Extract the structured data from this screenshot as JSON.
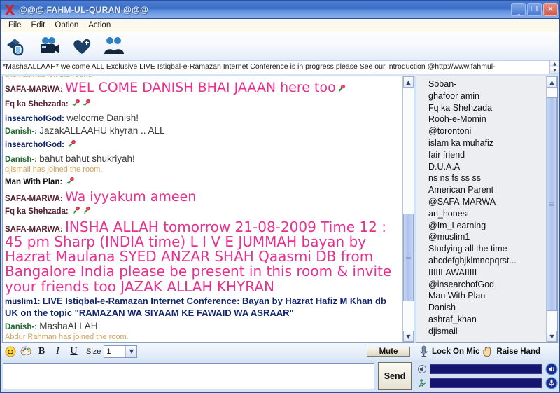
{
  "window": {
    "title": "@@@ FAHM-UL-QURAN @@@",
    "logo_icon": "red-x-logo",
    "minimize_label": "_",
    "restore_label": "❐",
    "close_label": "✕"
  },
  "menubar": {
    "items": [
      {
        "label": "File"
      },
      {
        "label": "Edit"
      },
      {
        "label": "Option"
      },
      {
        "label": "Action"
      }
    ]
  },
  "toolbar": {
    "buttons": [
      {
        "icon": "megaphone-broadcast-icon",
        "label": "Broadcast"
      },
      {
        "icon": "video-camera-icon",
        "label": "Webcam"
      },
      {
        "icon": "heart-plus-add-friend-icon",
        "label": "Add Friend"
      },
      {
        "icon": "people-users-icon",
        "label": "Users"
      }
    ]
  },
  "banner": {
    "text": "*MashaALLAAH* welcome ALL Exclusive LIVE Istiqbal-e-Ramazan Internet Conference is in progress please See our introduction @http://www.fahmul-",
    "scroll_up_icon": "caret-up-icon",
    "scroll_down_icon": "caret-down-icon"
  },
  "chat": {
    "messages": [
      {
        "type": "system",
        "text": "djismail has left the room."
      },
      {
        "type": "msg",
        "nick": "SAFA-MARWA:",
        "nick_color": "maroon",
        "text": "WEL COME DANISH BHAI JAAAN here too",
        "style": "pink",
        "roses": 1
      },
      {
        "type": "msg",
        "nick": "Fq ka Shehzada:",
        "nick_color": "maroon",
        "text": "",
        "style": "pink",
        "roses": 2
      },
      {
        "type": "msg",
        "nick": "insearchofGod:",
        "nick_color": "navy",
        "text": "welcome Danish!",
        "style": "plain",
        "roses": 0
      },
      {
        "type": "msg",
        "nick": "Danish-:",
        "nick_color": "green",
        "text": "JazakALLAAHU khyran .. ALL",
        "style": "plain",
        "roses": 0
      },
      {
        "type": "msg",
        "nick": "insearchofGod:",
        "nick_color": "navy",
        "text": "",
        "style": "plain",
        "roses": 1
      },
      {
        "type": "msg",
        "nick": "Danish-:",
        "nick_color": "green",
        "text": "bahut bahut shukriyah!",
        "style": "plain",
        "roses": 0
      },
      {
        "type": "system",
        "text": "djismail has joined the room."
      },
      {
        "type": "msg",
        "nick": "Man With Plan:",
        "nick_color": "black",
        "text": "",
        "style": "plain",
        "roses": 1
      },
      {
        "type": "msg",
        "nick": "SAFA-MARWA:",
        "nick_color": "maroon",
        "text": "Wa iyyakum ameen",
        "style": "pink",
        "roses": 0
      },
      {
        "type": "msg",
        "nick": "Fq ka Shehzada:",
        "nick_color": "maroon",
        "text": "",
        "style": "pink",
        "roses": 2
      },
      {
        "type": "msg",
        "nick": "SAFA-MARWA:",
        "nick_color": "maroon",
        "text": "INSHA ALLAH tomorrow 21-08-2009 Time 12 : 45 pm Sharp (INDIA time)  L I V E  JUMMAH bayan by Hazrat Maulana SYED ANZAR SHAH Qaasmi DB from Bangalore India please be present in this room & invite your friends too JAZAK ALLAH KHYRAN",
        "style": "pink-big",
        "roses": 0
      },
      {
        "type": "msg",
        "nick": "muslim1:",
        "nick_color": "navy",
        "text": "LIVE Istiqbal-e-Ramazan Internet Conference: Bayan by Hazrat Hafiz M Khan db UK on the topic \"RAMAZAN WA SIYAAM KE FAWAID WA ASRAAR\"",
        "style": "navybold",
        "roses": 0
      },
      {
        "type": "msg",
        "nick": "Danish-:",
        "nick_color": "green",
        "text": "MashaALLAH",
        "style": "plain",
        "roses": 0
      },
      {
        "type": "system",
        "text": "Abdur Rahman has joined the room."
      }
    ],
    "scroll_up_icon": "caret-up-icon",
    "scroll_down_icon": "caret-down-icon"
  },
  "users": {
    "items": [
      {
        "name": "Soban-"
      },
      {
        "name": "ghafoor amin"
      },
      {
        "name": "Fq ka Shehzada"
      },
      {
        "name": "Rooh-e-Momin"
      },
      {
        "name": "@torontoni"
      },
      {
        "name": "islam ka muhafiz"
      },
      {
        "name": "fair friend"
      },
      {
        "name": "D.U.A.A"
      },
      {
        "name": "ns ns fs ss ss"
      },
      {
        "name": "American Parent"
      },
      {
        "name": "@SAFA-MARWA"
      },
      {
        "name": "an_honest"
      },
      {
        "name": "@Im_Learning"
      },
      {
        "name": "@muslim1"
      },
      {
        "name": "Studying all the time"
      },
      {
        "name": "abcdefghjklmnopqrst..."
      },
      {
        "name": "IIIIILAWAIIIII"
      },
      {
        "name": "@insearchofGod"
      },
      {
        "name": "Man With Plan"
      },
      {
        "name": "Danish-"
      },
      {
        "name": "ashraf_khan"
      },
      {
        "name": "djismail"
      }
    ],
    "scroll_up_icon": "caret-up-icon",
    "scroll_down_icon": "caret-down-icon"
  },
  "format_bar": {
    "smiley_icon": "smiley-face-icon",
    "color_icon": "color-palette-icon",
    "bold_label": "B",
    "italic_label": "I",
    "underline_label": "U",
    "size_label": "Size",
    "size_value": "1",
    "size_arrow_icon": "chevron-down-icon",
    "mute_label": "Mute"
  },
  "mic_bar": {
    "mic_icon": "microphone-icon",
    "lock_on_mic_label": "Lock On Mic",
    "hand_icon": "raised-hand-icon",
    "raise_hand_label": "Raise Hand"
  },
  "input": {
    "value": "",
    "placeholder": "",
    "send_label": "Send"
  },
  "audio": {
    "speaker_row_icon": "speaker-level-icon",
    "mic_row_icon": "mic-level-icon",
    "speaker_button_icon": "speaker-toggle-icon",
    "mic_button_icon": "microphone-toggle-icon",
    "speaker_level": 100,
    "mic_level": 100
  },
  "colors": {
    "titlebar": "#3a6ec4",
    "pink_text": "#e8308f",
    "navy_text": "#11266f",
    "green_nick": "#1d6b2f",
    "maroon_nick": "#5a2030",
    "system_text": "#d4a259",
    "meter_fill": "#151570"
  }
}
